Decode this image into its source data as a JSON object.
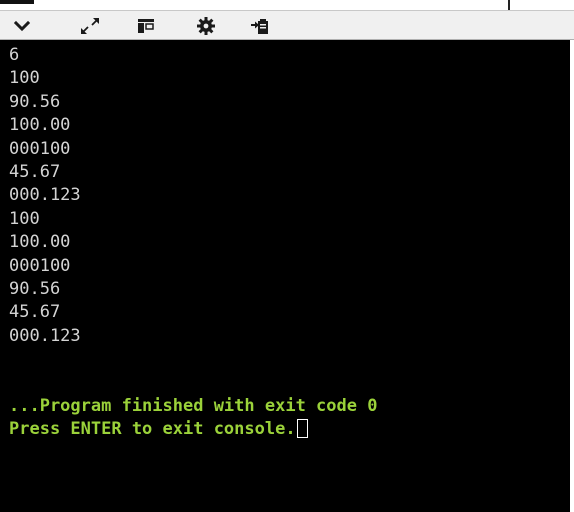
{
  "toolbar": {
    "buttons": [
      {
        "icon": "chevron-down-icon"
      },
      {
        "icon": "expand-icon"
      },
      {
        "icon": "layout-icon"
      },
      {
        "icon": "gear-icon"
      },
      {
        "icon": "export-icon"
      }
    ]
  },
  "console": {
    "output_lines": [
      "6",
      "100",
      "90.56",
      "100.00",
      "000100",
      "45.67",
      "000.123",
      "100",
      "100.00",
      "000100",
      "90.56",
      "45.67",
      "000.123"
    ],
    "finish_message": "...Program finished with exit code 0",
    "exit_prompt": "Press ENTER to exit console."
  },
  "colors": {
    "console_background": "#000000",
    "output_text": "#d4d4d4",
    "message_text": "#9bd23a",
    "toolbar_background": "#f0f0f0"
  }
}
